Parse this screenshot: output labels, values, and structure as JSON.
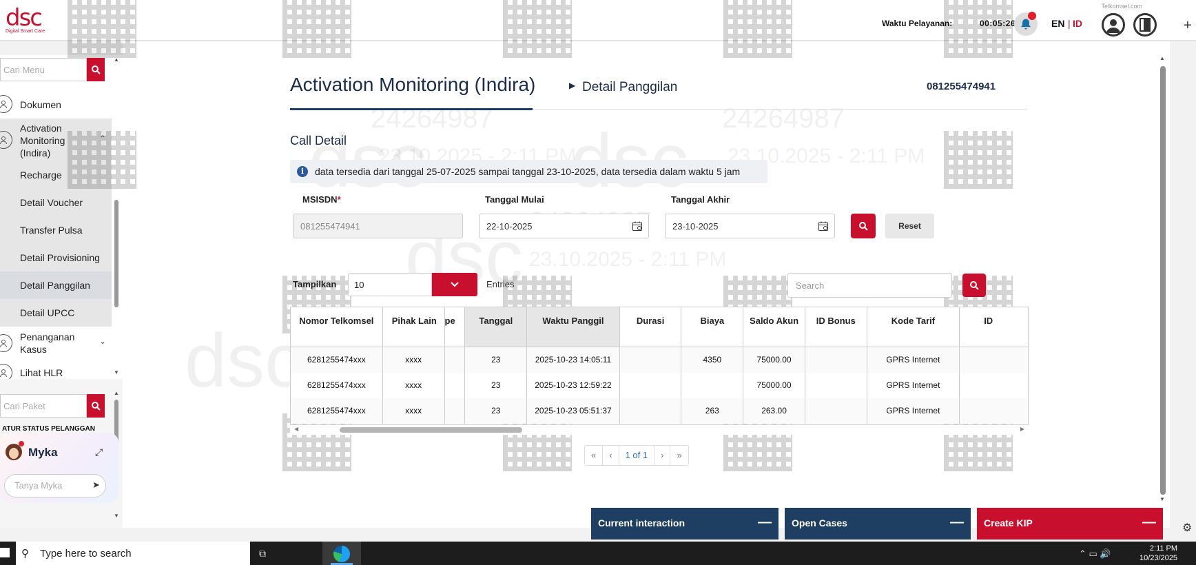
{
  "header": {
    "logo_text": "dsc",
    "logo_sub": "Digital Smart Care",
    "telkomsel_label": "Telkomsel.com",
    "waktu_label": "Waktu Pelayanan:",
    "waktu_value": "00:05:26",
    "lang_en": "EN",
    "lang_sep": "|",
    "lang_id": "ID"
  },
  "sidebar": {
    "search_placeholder": "Cari Menu",
    "items": [
      {
        "label": "Dokumen"
      },
      {
        "label": "Activation Monitoring (Indira)"
      },
      {
        "label": "Recharge"
      },
      {
        "label": "Detail Voucher"
      },
      {
        "label": "Transfer Pulsa"
      },
      {
        "label": "Detail Provisioning"
      },
      {
        "label": "Detail Panggilan"
      },
      {
        "label": "Detail UPCC"
      },
      {
        "label": "Penanganan Kasus"
      },
      {
        "label": "Lihat HLR"
      }
    ],
    "paket_placeholder": "Cari Paket",
    "atur_status": "ATUR STATUS PELANGGAN",
    "myka_name": "Myka",
    "tanya_placeholder": "Tanya Myka"
  },
  "main": {
    "page_title": "Activation Monitoring (Indira)",
    "breadcrumb": "Detail Panggilan",
    "msisdn_header": "081255474941",
    "section_title": "Call Detail",
    "info_text": "data tersedia dari tanggal 25-07-2025 sampai tanggal 23-10-2025, data tersedia dalam waktu 5 jam",
    "form": {
      "msisdn_label": "MSISDN",
      "msisdn_required": "*",
      "msisdn_value": "081255474941",
      "start_label": "Tanggal Mulai",
      "start_value": "22-10-2025",
      "end_label": "Tanggal Akhir",
      "end_value": "23-10-2025",
      "reset_label": "Reset"
    },
    "tampilkan_label": "Tampilkan",
    "entries_value": "10",
    "entries_label": "Entries",
    "search_placeholder": "Search",
    "table": {
      "headers": [
        "Nomor Telkomsel",
        "Pihak Lain",
        "pe",
        "Tanggal",
        "Waktu Panggil",
        "Durasi",
        "Biaya",
        "Saldo Akun",
        "ID Bonus",
        "Kode Tarif",
        "ID"
      ],
      "rows": [
        [
          "6281255474xxx",
          "xxxx",
          "",
          "23",
          "2025-10-23 14:05:11",
          "",
          "4350",
          "75000.00",
          "",
          "GPRS Internet",
          ""
        ],
        [
          "6281255474xxx",
          "xxxx",
          "",
          "23",
          "2025-10-23 12:59:22",
          "",
          "",
          "75000.00",
          "",
          "GPRS Internet",
          ""
        ],
        [
          "6281255474xxx",
          "xxxx",
          "",
          "23",
          "2025-10-23 05:51:37",
          "",
          "263",
          "263.00",
          "",
          "GPRS Internet",
          ""
        ]
      ]
    },
    "pager": {
      "first": "«",
      "prev": "‹",
      "current": "1 of 1",
      "next": "›",
      "last": "»"
    }
  },
  "panels": {
    "current_interaction": "Current interaction",
    "open_cases": "Open Cases",
    "create_kip": "Create KIP",
    "minimize": "—"
  },
  "watermark": {
    "id": "24264987",
    "datetime": "23.10.2025 - 2:11 PM"
  },
  "taskbar": {
    "search_text": "Type here to search",
    "time": "2:11 PM",
    "date": "10/23/2025"
  },
  "colors": {
    "brand_red": "#c8102e",
    "navy": "#1e3e62",
    "title_blue": "#1c2d4a"
  }
}
